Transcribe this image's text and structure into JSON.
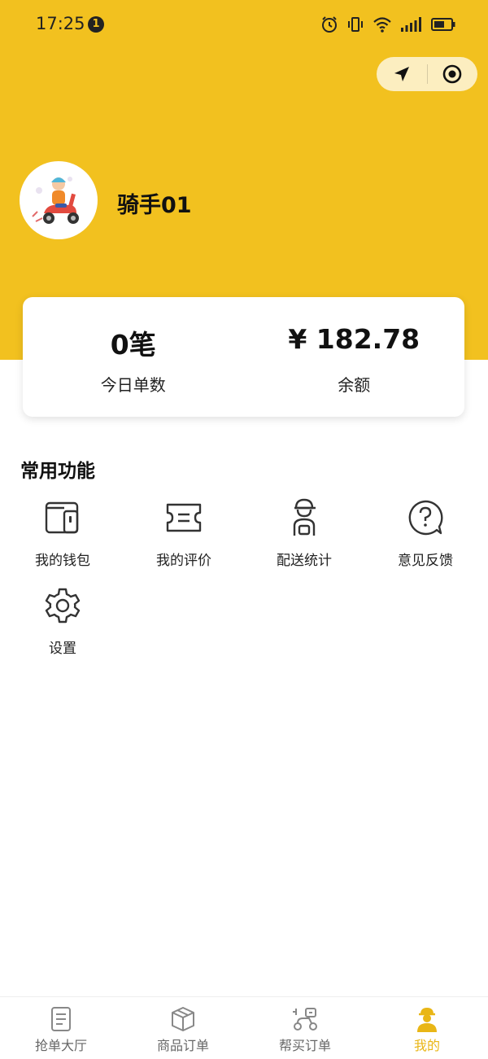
{
  "status_bar": {
    "time": "17:25",
    "notification_count": "1"
  },
  "profile": {
    "name": "骑手01"
  },
  "stats": {
    "orders_value": "0笔",
    "orders_label": "今日单数",
    "balance_value": "¥ 182.78",
    "balance_label": "余额"
  },
  "functions": {
    "title": "常用功能",
    "items": [
      {
        "label": "我的钱包",
        "icon": "wallet-icon"
      },
      {
        "label": "我的评价",
        "icon": "ticket-icon"
      },
      {
        "label": "配送统计",
        "icon": "courier-icon"
      },
      {
        "label": "意见反馈",
        "icon": "question-icon"
      },
      {
        "label": "设置",
        "icon": "gear-icon"
      }
    ]
  },
  "bottom_nav": {
    "items": [
      {
        "label": "抢单大厅",
        "icon": "document-icon",
        "active": false
      },
      {
        "label": "商品订单",
        "icon": "package-icon",
        "active": false
      },
      {
        "label": "帮买订单",
        "icon": "scooter-icon",
        "active": false
      },
      {
        "label": "我的",
        "icon": "rider-icon",
        "active": true
      }
    ]
  },
  "colors": {
    "brand_yellow": "#F2C11F",
    "active_tab": "#E9B616"
  }
}
